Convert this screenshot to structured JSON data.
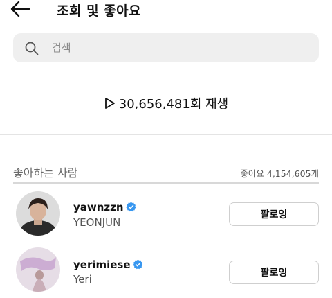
{
  "header": {
    "title": "조회 및 좋아요"
  },
  "search": {
    "placeholder": "검색"
  },
  "plays": {
    "text": "30,656,481회 재생"
  },
  "likes": {
    "label": "좋아하는 사람",
    "count": "좋아요 4,154,605개"
  },
  "users": [
    {
      "username": "yawnzzn",
      "fullname": "YEONJUN",
      "verified": true,
      "button": "팔로잉"
    },
    {
      "username": "yerimiese",
      "fullname": "Yeri",
      "verified": true,
      "button": "팔로잉"
    }
  ],
  "colors": {
    "verified": "#3897f0",
    "divider": "#e4e4e4",
    "searchBg": "#efefef"
  }
}
